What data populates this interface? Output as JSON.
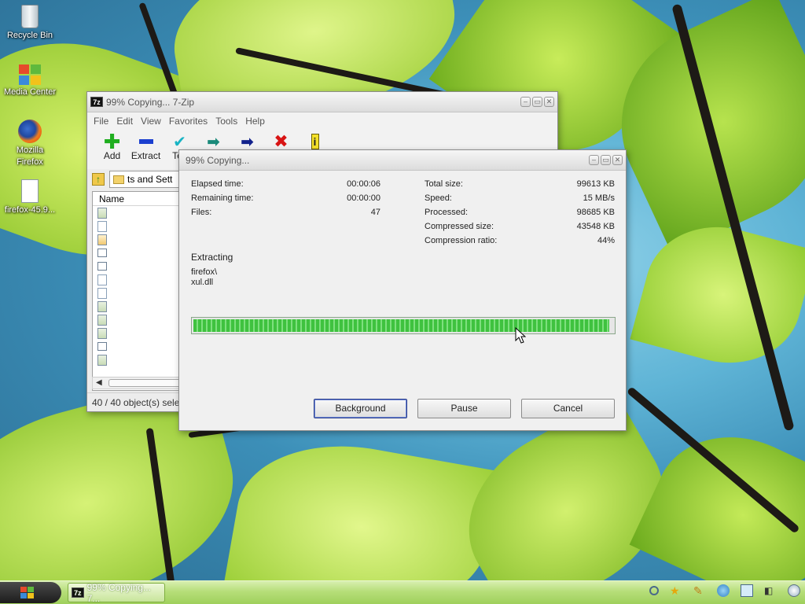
{
  "desktop": {
    "icons": [
      {
        "label": "Recycle Bin"
      },
      {
        "label": "Media Center"
      },
      {
        "label": "Mozilla Firefox"
      },
      {
        "label": "firefox-45.9..."
      }
    ]
  },
  "main_window": {
    "title": "99% Copying... 7-Zip",
    "app_icon": "7z",
    "menu": [
      "File",
      "Edit",
      "View",
      "Favorites",
      "Tools",
      "Help"
    ],
    "toolbar": [
      {
        "label": "Add",
        "icon": "plus-icon"
      },
      {
        "label": "Extract",
        "icon": "minus-icon"
      },
      {
        "label": "Tes",
        "icon": "check-icon"
      },
      {
        "label": "",
        "icon": "copy-arrow-icon"
      },
      {
        "label": "",
        "icon": "move-arrow-icon"
      },
      {
        "label": "",
        "icon": "delete-icon"
      },
      {
        "label": "",
        "icon": "info-icon"
      }
    ],
    "address": "ts and Sett",
    "column_name": "Name",
    "status": "40 / 40 object(s) selec"
  },
  "dialog": {
    "title": "99% Copying...",
    "left_stats": [
      {
        "label": "Elapsed time:",
        "value": "00:00:06"
      },
      {
        "label": "Remaining time:",
        "value": "00:00:00"
      },
      {
        "label": "Files:",
        "value": "47"
      }
    ],
    "right_stats": [
      {
        "label": "Total size:",
        "value": "99613 KB"
      },
      {
        "label": "Speed:",
        "value": "15 MB/s"
      },
      {
        "label": "Processed:",
        "value": "98685 KB"
      },
      {
        "label": "Compressed size:",
        "value": "43548 KB"
      },
      {
        "label": "Compression ratio:",
        "value": "44%"
      }
    ],
    "operation": "Extracting",
    "current_path": "firefox\\",
    "current_file": "xul.dll",
    "progress_percent": 99,
    "buttons": {
      "background": "Background",
      "pause": "Pause",
      "cancel": "Cancel"
    }
  },
  "taskbar": {
    "task_label": "99% Copying... 7...",
    "task_icon": "7z"
  },
  "colors": {
    "progress_green": "#3fc23f",
    "taskbar_green": "#b6de79"
  }
}
